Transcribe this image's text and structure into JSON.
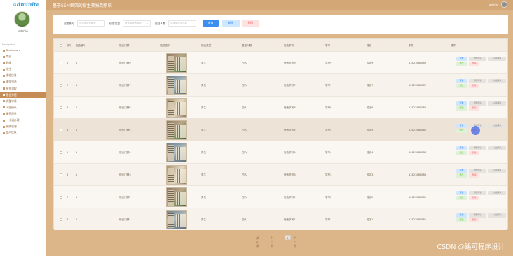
{
  "app": {
    "logo": "Adminlte",
    "title": "基于SSM框架的新生预报到系统",
    "user": "admin",
    "admin_name": "admin"
  },
  "sidebar": {
    "nav_title": "Navigation",
    "items": [
      {
        "label": "Dashboard",
        "icon": "home-icon"
      },
      {
        "label": "专业",
        "icon": "list-icon"
      },
      {
        "label": "班级",
        "icon": "list-icon"
      },
      {
        "label": "学生",
        "icon": "user-icon"
      },
      {
        "label": "课程信息",
        "icon": "book-icon"
      },
      {
        "label": "课程预选",
        "icon": "list-icon"
      },
      {
        "label": "报到流程",
        "icon": "flow-icon"
      },
      {
        "label": "宿舍分配",
        "icon": "home-icon",
        "active": true
      },
      {
        "label": "调整申请",
        "icon": "list-icon"
      },
      {
        "label": "入住确认",
        "icon": "list-icon"
      },
      {
        "label": "缴费项目",
        "icon": "money-icon"
      },
      {
        "label": "一卡通办理",
        "icon": "card-icon"
      },
      {
        "label": "系统管理",
        "icon": "gear-icon",
        "expandable": true
      },
      {
        "label": "用户信息",
        "icon": "user-icon",
        "expandable": true
      }
    ]
  },
  "search": {
    "field1_label": "宿舍编号",
    "field1_placeholder": "请选择宿舍编号",
    "field2_label": "宿舍类型",
    "field2_placeholder": "请选择宿舍类型",
    "field3_label": "居住人数",
    "field3_placeholder": "请选择居住人数",
    "search_label": "查询",
    "add_label": "新增",
    "delete_label": "删除"
  },
  "table": {
    "columns": [
      "序号",
      "宿舍编号",
      "宿舍门牌",
      "宿舍图片",
      "宿舍类型",
      "居住人数",
      "宿舍学号",
      "学号",
      "姓名",
      "手机",
      "操作"
    ],
    "rows": [
      {
        "idx": "1",
        "code": "1",
        "door": "宿舍门牌9",
        "type": "男生",
        "people": "四人",
        "sid": "宿舍学号9",
        "no": "学号9",
        "name": "姓名9",
        "phone": "13823888889",
        "photo": "v1"
      },
      {
        "idx": "2",
        "code": "1",
        "door": "宿舍门牌7",
        "type": "男生",
        "people": "四人",
        "sid": "宿舍学号7",
        "no": "学号7",
        "name": "姓名7",
        "phone": "13823888887",
        "photo": "v2"
      },
      {
        "idx": "3",
        "code": "1",
        "door": "宿舍门牌6",
        "type": "男生",
        "people": "四人",
        "sid": "宿舍学号6",
        "no": "学号6",
        "name": "姓名6",
        "phone": "13823888886",
        "photo": "v3"
      },
      {
        "idx": "4",
        "code": "1",
        "door": "宿舍门牌5",
        "type": "男生",
        "people": "四人",
        "sid": "宿舍学号5",
        "no": "学号5",
        "name": "姓名5",
        "phone": "13823888885",
        "photo": "v1"
      },
      {
        "idx": "5",
        "code": "1",
        "door": "宿舍门牌4",
        "type": "男生",
        "people": "四人",
        "sid": "宿舍学号4",
        "no": "学号4",
        "name": "姓名4",
        "phone": "13823888884",
        "photo": "v2"
      },
      {
        "idx": "6",
        "code": "1",
        "door": "宿舍门牌3",
        "type": "男生",
        "people": "四人",
        "sid": "宿舍学号3",
        "no": "学号3",
        "name": "姓名3",
        "phone": "13823888883",
        "photo": "v3"
      },
      {
        "idx": "7",
        "code": "1",
        "door": "宿舍门牌2",
        "type": "男生",
        "people": "四人",
        "sid": "宿舍学号2",
        "no": "学号2",
        "name": "姓名2",
        "phone": "13823888882",
        "photo": "v1"
      },
      {
        "idx": "8",
        "code": "1",
        "door": "宿舍门牌1",
        "type": "男生",
        "people": "四人",
        "sid": "宿舍学号1",
        "no": "学号1",
        "name": "姓名1",
        "phone": "13823888881",
        "photo": "v2"
      }
    ],
    "actions": {
      "view": "查看",
      "adjust": "调整申请",
      "checkin": "入住确认",
      "edit": "修改",
      "delete": "删除"
    }
  },
  "pager": {
    "total": "共8条",
    "prev": "上一页",
    "current": "1",
    "next": "下一页"
  },
  "watermark": "CSDN @路可程序设计"
}
